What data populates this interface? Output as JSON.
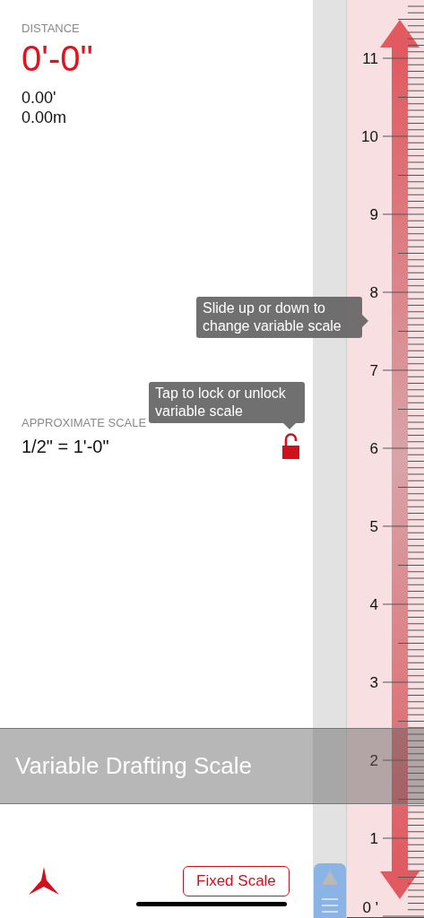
{
  "distance": {
    "label": "DISTANCE",
    "value": "0'-0\"",
    "feet": "0.00'",
    "meters": "0.00m"
  },
  "scale": {
    "label": "APPROXIMATE SCALE",
    "value": "1/2\" = 1'-0\"",
    "locked": false
  },
  "tooltips": [
    {
      "text": "Slide up or down to change variable scale",
      "kind": "right"
    },
    {
      "text": "Tap to lock or unlock variable scale",
      "kind": "down"
    }
  ],
  "banner": {
    "title": "Variable Drafting Scale"
  },
  "ruler": {
    "labels": [
      "11",
      "10",
      "9",
      "8",
      "7",
      "6",
      "5",
      "4",
      "3",
      "2",
      "1",
      "0 '"
    ]
  },
  "fixed_scale_button": "Fixed Scale"
}
